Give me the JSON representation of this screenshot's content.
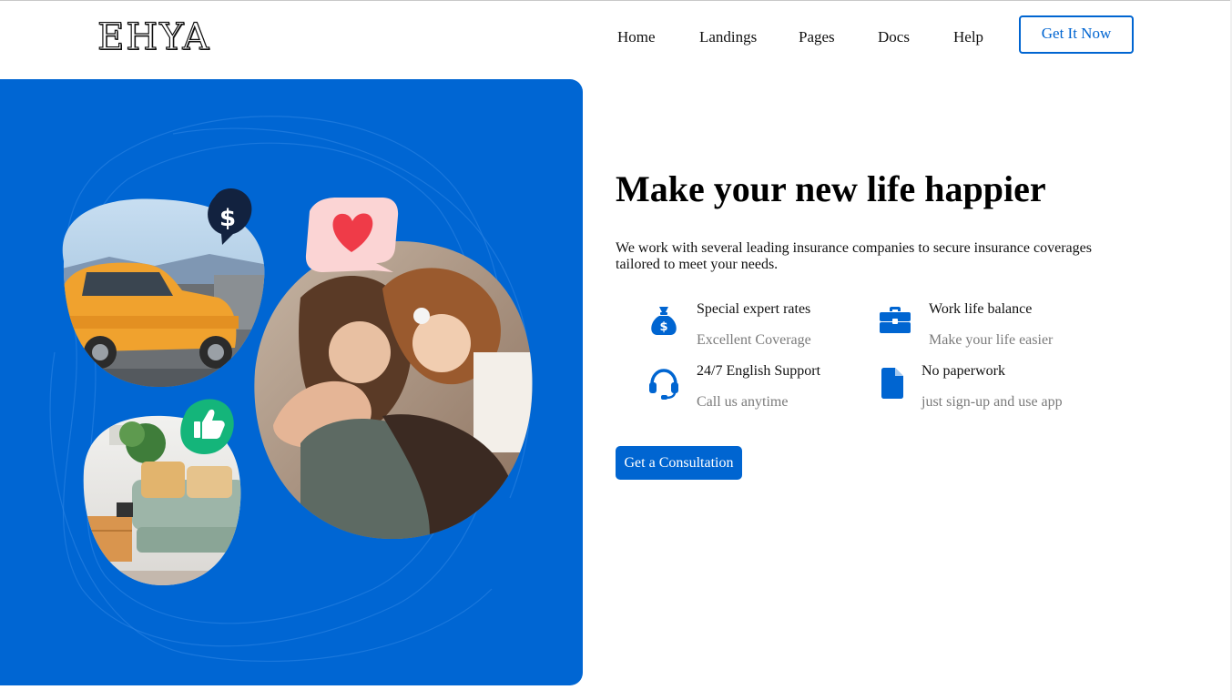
{
  "brand": {
    "logo_text": "EHYA"
  },
  "nav": {
    "items": [
      {
        "label": "Home"
      },
      {
        "label": "Landings"
      },
      {
        "label": "Pages"
      },
      {
        "label": "Docs"
      },
      {
        "label": "Help"
      }
    ],
    "cta_label": "Get It Now"
  },
  "hero": {
    "headline": "Make your new life happier",
    "lead": "We work with several leading insurance companies to secure insurance coverages tailored to meet your needs.",
    "features": [
      {
        "title": "Special expert rates",
        "subtitle": "Excellent Coverage",
        "icon": "money-bag-icon"
      },
      {
        "title": "Work life balance",
        "subtitle": "Make your life easier",
        "icon": "briefcase-icon"
      },
      {
        "title": "24/7 English Support",
        "subtitle": "Call us anytime",
        "icon": "headset-icon"
      },
      {
        "title": "No paperwork",
        "subtitle": "just sign-up and use app",
        "icon": "document-icon"
      }
    ],
    "cta_label": "Get a Consultation",
    "bubbles": {
      "dollar_symbol": "$"
    }
  },
  "colors": {
    "primary": "#0065d1",
    "panel": "#0066d3",
    "muted_text": "#7b7b7b",
    "bubble_dark": "#12223f",
    "bubble_pink": "#fbd4d4",
    "heart": "#ef3b48",
    "bubble_green": "#14b57a"
  }
}
